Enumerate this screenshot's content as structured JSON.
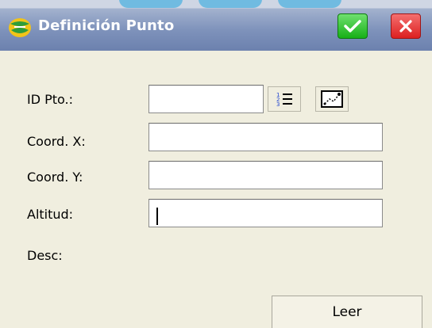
{
  "window": {
    "title": "Definición Punto",
    "ok_icon": "checkmark-icon",
    "close_icon": "close-icon"
  },
  "form": {
    "fields": [
      {
        "label": "ID Pto.:",
        "value": ""
      },
      {
        "label": "Coord. X:",
        "value": ""
      },
      {
        "label": "Coord. Y:",
        "value": ""
      },
      {
        "label": "Altitud:",
        "value": ""
      }
    ],
    "desc_label": "Desc:",
    "list_button_icon": "numbered-list-icon",
    "pick_button_icon": "map-pick-icon"
  },
  "footer": {
    "read_button_label": "Leer"
  },
  "colors": {
    "titlebar": "#7e92bb",
    "background": "#f0eedf",
    "ok": "#17b017",
    "close": "#dc2020"
  }
}
